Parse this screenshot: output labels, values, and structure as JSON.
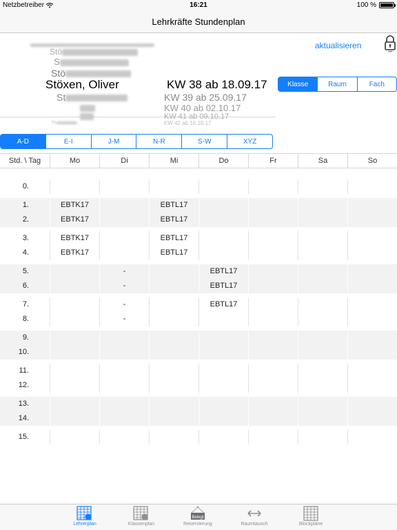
{
  "status": {
    "carrier": "Netzbetreiber",
    "time": "16:21",
    "battery": "100 %"
  },
  "nav": {
    "title": "Lehrkräfte Stundenplan"
  },
  "refresh_label": "aktualisieren",
  "picker": {
    "teacher_fragments": [
      "Stö",
      "S",
      "Stö",
      "St",
      "Th"
    ],
    "teacher_selected": "Stöxen, Oliver",
    "week_selected": "KW 38 ab 18.09.17",
    "weeks_below": [
      "KW 39 ab 25.09.17",
      "KW 40 ab 02.10.17",
      "KW 41 ab 09.10.17",
      "KW 42 ab 16.10.17"
    ]
  },
  "type_segments": [
    "Klasse",
    "Raum",
    "Fach"
  ],
  "type_selected": 0,
  "alpha_segments": [
    "A-D",
    "E-I",
    "J-M",
    "N-R",
    "S-W",
    "XYZ"
  ],
  "alpha_selected": 0,
  "timetable": {
    "headers": [
      "Std. \\ Tag",
      "Mo",
      "Di",
      "Mi",
      "Do",
      "Fr",
      "Sa",
      "So"
    ],
    "rows": [
      [
        "0.",
        "",
        "",
        "",
        "",
        "",
        "",
        ""
      ],
      [
        "1.",
        "EBTK17",
        "",
        "EBTL17",
        "",
        "",
        "",
        ""
      ],
      [
        "2.",
        "EBTK17",
        "",
        "EBTL17",
        "",
        "",
        "",
        ""
      ],
      [
        "3.",
        "EBTK17",
        "",
        "EBTL17",
        "",
        "",
        "",
        ""
      ],
      [
        "4.",
        "EBTK17",
        "",
        "EBTL17",
        "",
        "",
        "",
        ""
      ],
      [
        "5.",
        "",
        "-",
        "",
        "EBTL17",
        "",
        "",
        ""
      ],
      [
        "6.",
        "",
        "-",
        "",
        "EBTL17",
        "",
        "",
        ""
      ],
      [
        "7.",
        "",
        "-",
        "",
        "EBTL17",
        "",
        "",
        ""
      ],
      [
        "8.",
        "",
        "-",
        "",
        "",
        "",
        "",
        ""
      ],
      [
        "9.",
        "",
        "",
        "",
        "",
        "",
        "",
        ""
      ],
      [
        "10.",
        "",
        "",
        "",
        "",
        "",
        "",
        ""
      ],
      [
        "11.",
        "",
        "",
        "",
        "",
        "",
        "",
        ""
      ],
      [
        "12.",
        "",
        "",
        "",
        "",
        "",
        "",
        ""
      ],
      [
        "13.",
        "",
        "",
        "",
        "",
        "",
        "",
        ""
      ],
      [
        "14.",
        "",
        "",
        "",
        "",
        "",
        "",
        ""
      ],
      [
        "15.",
        "",
        "",
        "",
        "",
        "",
        "",
        ""
      ]
    ]
  },
  "tabs": [
    {
      "label": "Lehrerplan",
      "icon": "teacher-plan-icon",
      "active": true
    },
    {
      "label": "Klassenplan",
      "icon": "class-plan-icon",
      "active": false
    },
    {
      "label": "Reservierung",
      "icon": "reservation-icon",
      "badge": "Belegt",
      "active": false
    },
    {
      "label": "Raumtausch",
      "icon": "room-swap-icon",
      "active": false
    },
    {
      "label": "Blockpläne",
      "icon": "block-plans-icon",
      "active": false
    }
  ],
  "colors": {
    "accent": "#147efb",
    "shade": "#f2f2f2"
  }
}
